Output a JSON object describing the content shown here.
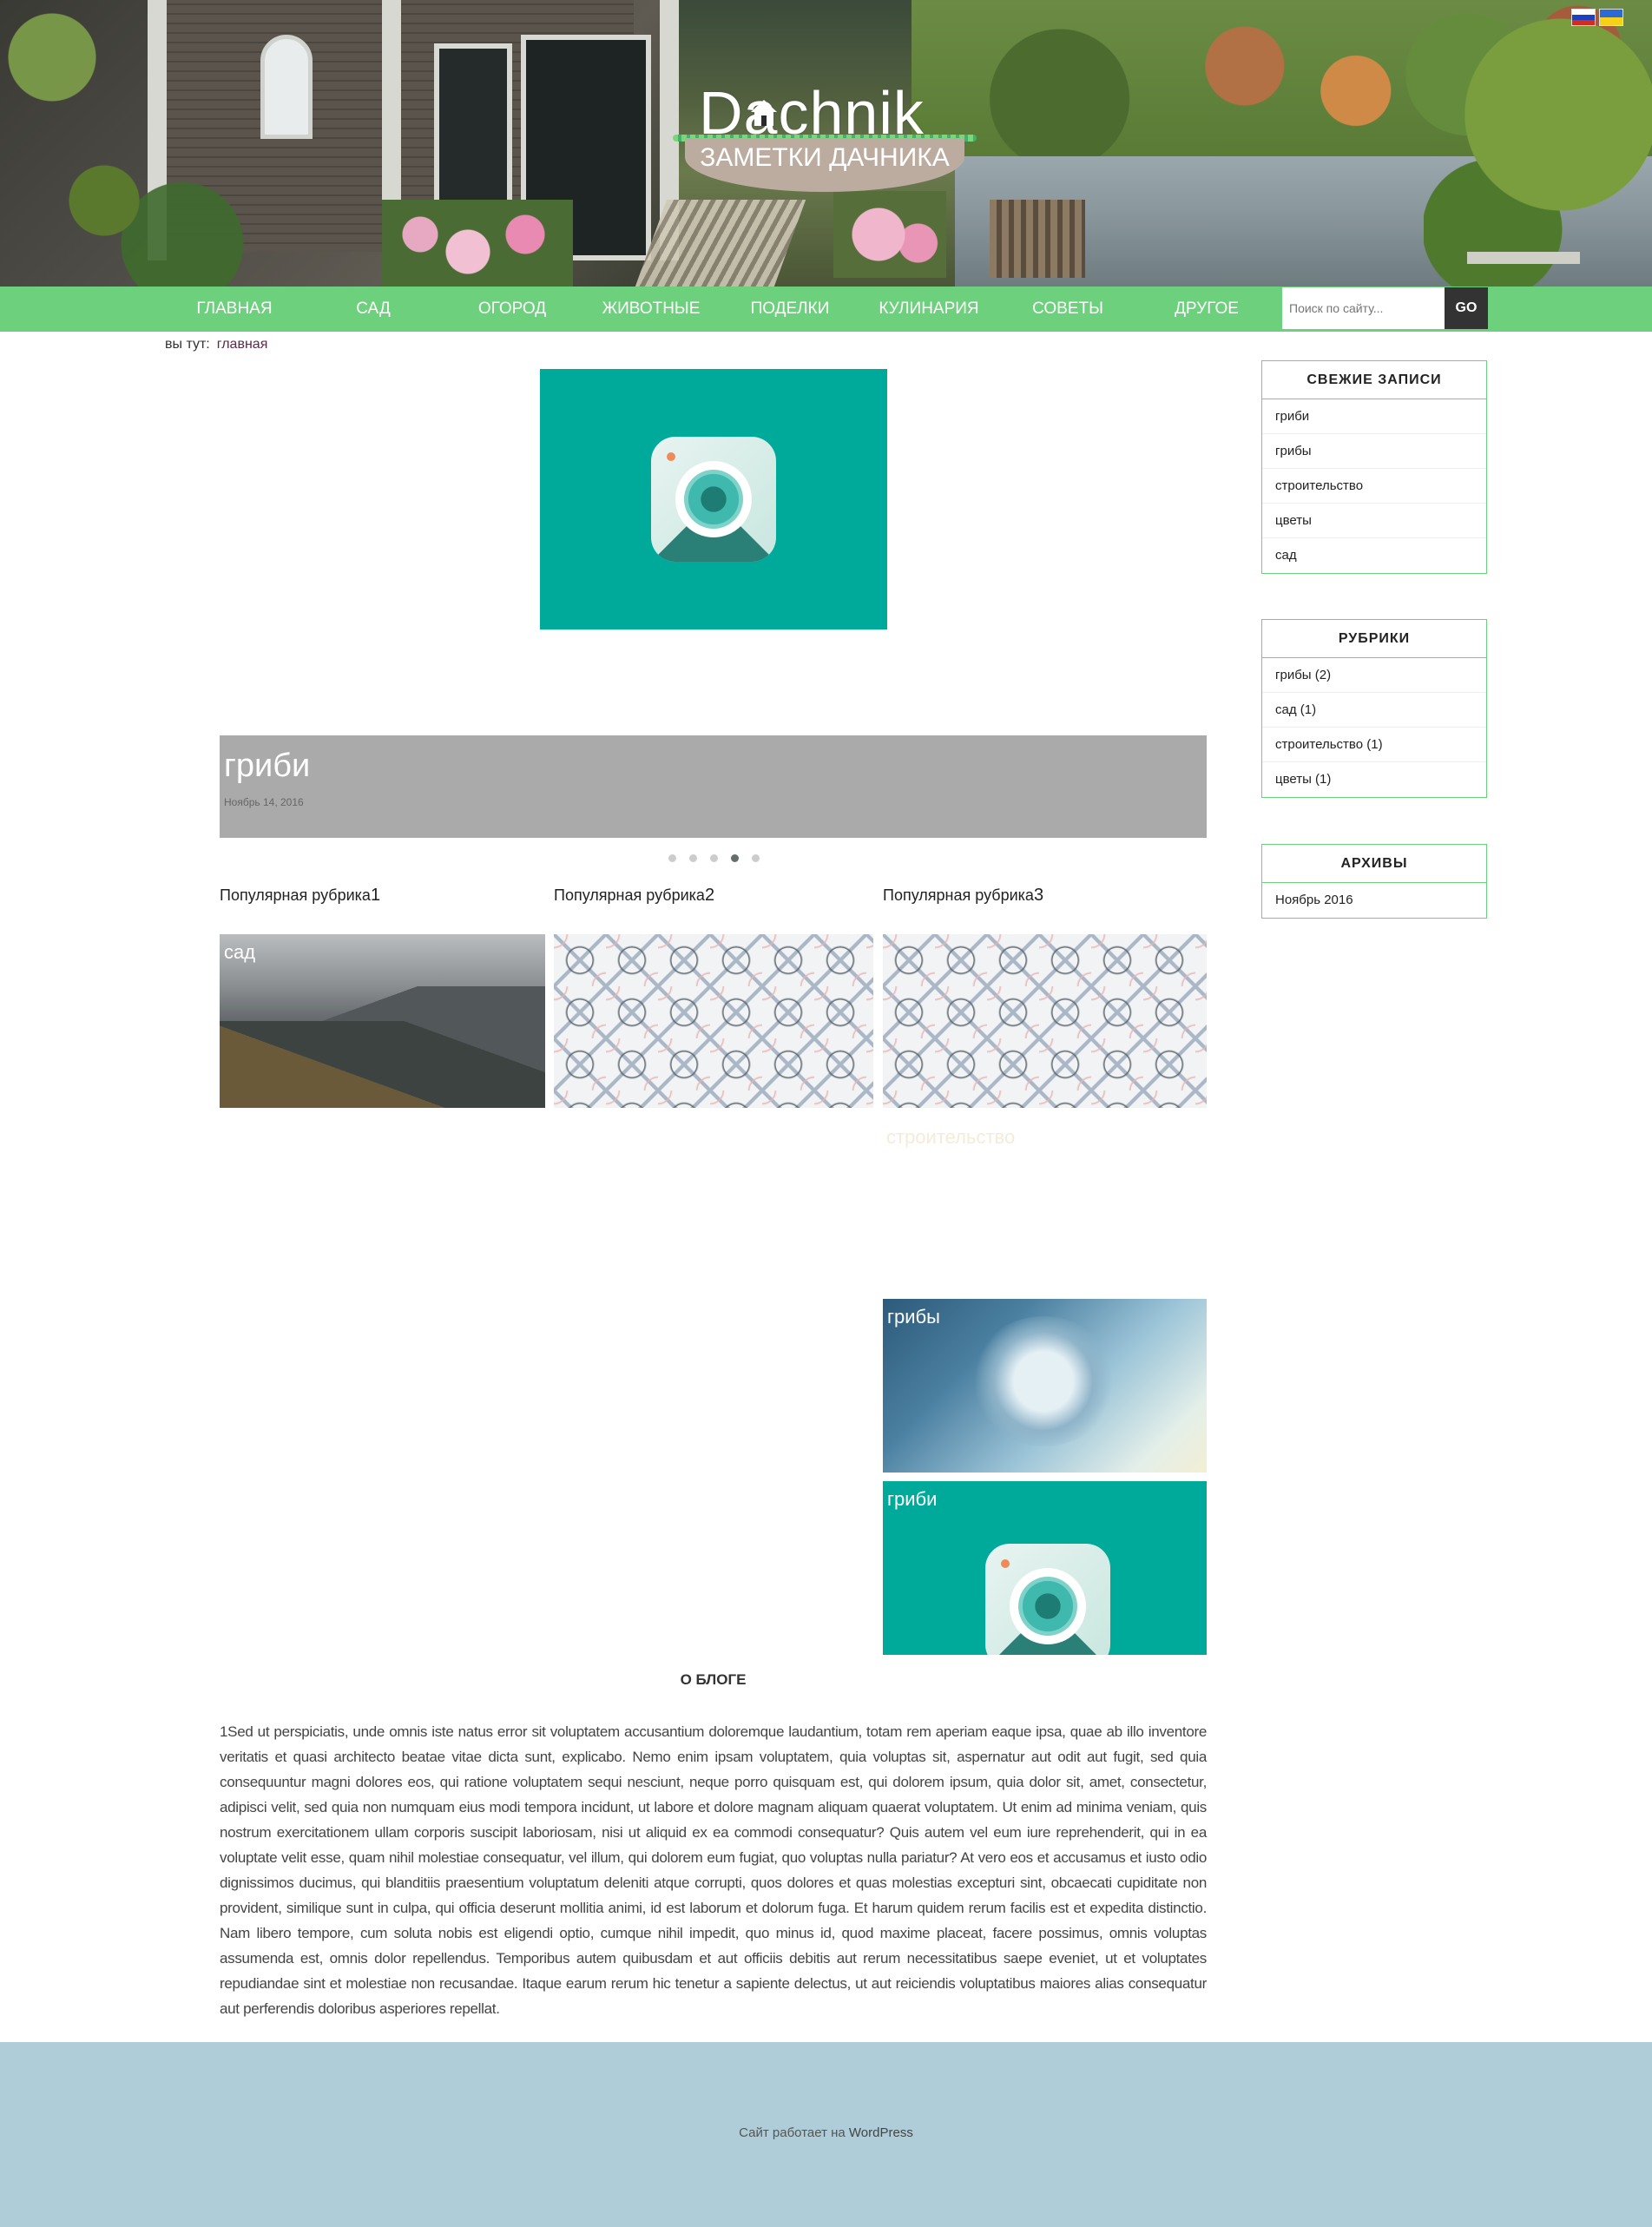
{
  "header": {
    "brand": "Dachnik",
    "tagline": "ЗАМЕТКИ ДАЧНИКА",
    "flags": [
      "ru",
      "ua"
    ]
  },
  "nav": {
    "items": [
      "ГЛАВНАЯ",
      "САД",
      "ОГОРОД",
      "ЖИВОТНЫЕ",
      "ПОДЕЛКИ",
      "КУЛИНАРИЯ",
      "СОВЕТЫ",
      "ДРУГОЕ"
    ],
    "search_placeholder": "Поиск по сайту...",
    "search_button": "GO"
  },
  "breadcrumb": {
    "prefix": "вы тут:",
    "current": "главная"
  },
  "slider": {
    "title": "гриби",
    "date": "Ноябрь 14, 2016",
    "dot_count": 5,
    "active_dot": 4
  },
  "categories": {
    "headings": [
      {
        "text": "Популярная рубрика",
        "num": "1"
      },
      {
        "text": "Популярная рубрика",
        "num": "2"
      },
      {
        "text": "Популярная рубрика",
        "num": "3"
      }
    ],
    "tiles": {
      "col1": "сад",
      "col3_ghost": "строительство",
      "col3_a": "грибы",
      "col3_b": "гриби"
    }
  },
  "sidebar": {
    "recent": {
      "title": "СВЕЖИЕ ЗАПИСИ",
      "items": [
        "гриби",
        "грибы",
        "строительство",
        "цветы",
        "сад"
      ]
    },
    "rubrics": {
      "title": "РУБРИКИ",
      "items": [
        "грибы (2)",
        "сад (1)",
        "строительство (1)",
        "цветы (1)"
      ]
    },
    "archives": {
      "title": "АРХИВЫ",
      "items": [
        "Ноябрь 2016"
      ]
    }
  },
  "about": {
    "title": "О БЛОГЕ",
    "text": "1Sed ut perspiciatis, unde omnis iste natus error sit voluptatem accusantium doloremque laudantium, totam rem aperiam eaque ipsa, quae ab illo inventore veritatis et quasi architecto beatae vitae dicta sunt, explicabo. Nemo enim ipsam voluptatem, quia voluptas sit, aspernatur aut odit aut fugit, sed quia consequuntur magni dolores eos, qui ratione voluptatem sequi nesciunt, neque porro quisquam est, qui dolorem ipsum, quia dolor sit, amet, consectetur, adipisci velit, sed quia non numquam eius modi tempora incidunt, ut labore et dolore magnam aliquam quaerat voluptatem. Ut enim ad minima veniam, quis nostrum exercitationem ullam corporis suscipit laboriosam, nisi ut aliquid ex ea commodi consequatur? Quis autem vel eum iure reprehenderit, qui in ea voluptate velit esse, quam nihil molestiae consequatur, vel illum, qui dolorem eum fugiat, quo voluptas nulla pariatur? At vero eos et accusamus et iusto odio dignissimos ducimus, qui blanditiis praesentium voluptatum deleniti atque corrupti, quos dolores et quas molestias excepturi sint, obcaecati cupiditate non provident, similique sunt in culpa, qui officia deserunt mollitia animi, id est laborum et dolorum fuga. Et harum quidem rerum facilis est et expedita distinctio. Nam libero tempore, cum soluta nobis est eligendi optio, cumque nihil impedit, quo minus id, quod maxime placeat, facere possimus, omnis voluptas assumenda est, omnis dolor repellendus. Temporibus autem quibusdam et aut officiis debitis aut rerum necessitatibus saepe eveniet, ut et voluptates repudiandae sint et molestiae non recusandae. Itaque earum rerum hic tenetur a sapiente delectus, ut aut reiciendis voluptatibus maiores alias consequatur aut perferendis doloribus asperiores repellat."
  },
  "footer": {
    "text": "Сайт работает на",
    "link": "WordPress"
  },
  "colors": {
    "nav": "#6dd07c",
    "teal": "#00aa9b",
    "footer": "#aecdd8",
    "caption": "#aaaaaa"
  }
}
